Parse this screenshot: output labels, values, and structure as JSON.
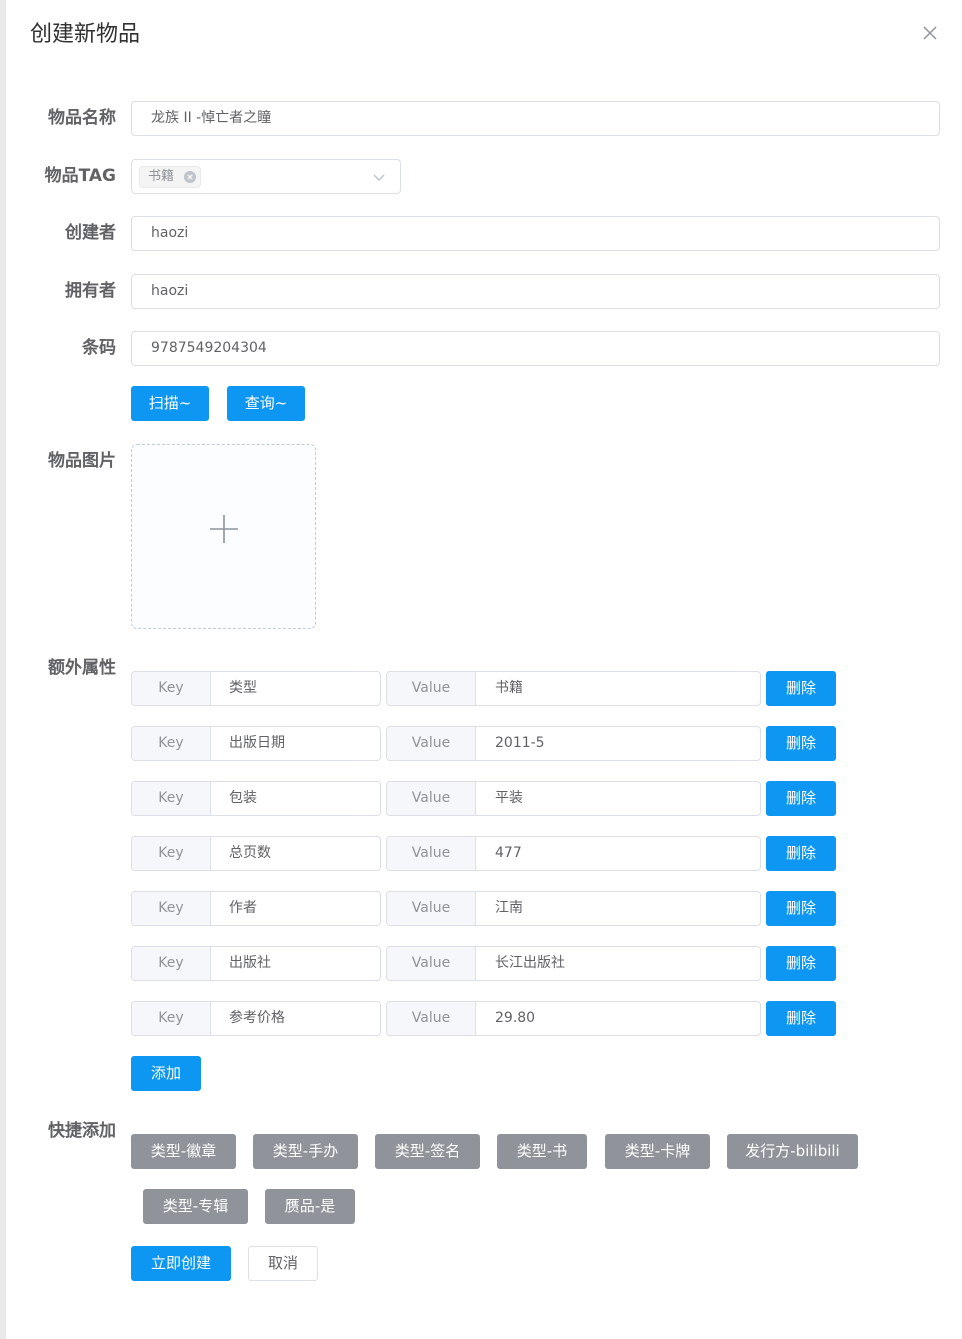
{
  "dialog": {
    "title": "创建新物品"
  },
  "form": {
    "name": {
      "label": "物品名称",
      "value": "龙族 II -悼亡者之瞳"
    },
    "tag": {
      "label": "物品TAG",
      "selected": [
        "书籍"
      ]
    },
    "creator": {
      "label": "创建者",
      "value": "haozi"
    },
    "owner": {
      "label": "拥有者",
      "value": "haozi"
    },
    "barcode": {
      "label": "条码",
      "value": "9787549204304"
    },
    "scan_label": "扫描~",
    "query_label": "查询~",
    "image": {
      "label": "物品图片"
    },
    "extra": {
      "label": "额外属性",
      "key_prefix": "Key",
      "value_prefix": "Value",
      "delete_label": "删除",
      "add_label": "添加",
      "rows": [
        {
          "key": "类型",
          "value": "书籍"
        },
        {
          "key": "出版日期",
          "value": "2011-5"
        },
        {
          "key": "包装",
          "value": "平装"
        },
        {
          "key": "总页数",
          "value": "477"
        },
        {
          "key": "作者",
          "value": "江南"
        },
        {
          "key": "出版社",
          "value": "长江出版社"
        },
        {
          "key": "参考价格",
          "value": "29.80"
        }
      ]
    },
    "quick": {
      "label": "快捷添加",
      "buttons": [
        "类型-徽章",
        "类型-手办",
        "类型-签名",
        "类型-书",
        "类型-卡牌",
        "发行方-bilibili",
        "类型-专辑",
        "赝品-是"
      ]
    },
    "submit_label": "立即创建",
    "cancel_label": "取消"
  },
  "colors": {
    "primary": "#0d96f2",
    "info": "#909399",
    "border": "#dcdfe6",
    "label": "#606266"
  }
}
